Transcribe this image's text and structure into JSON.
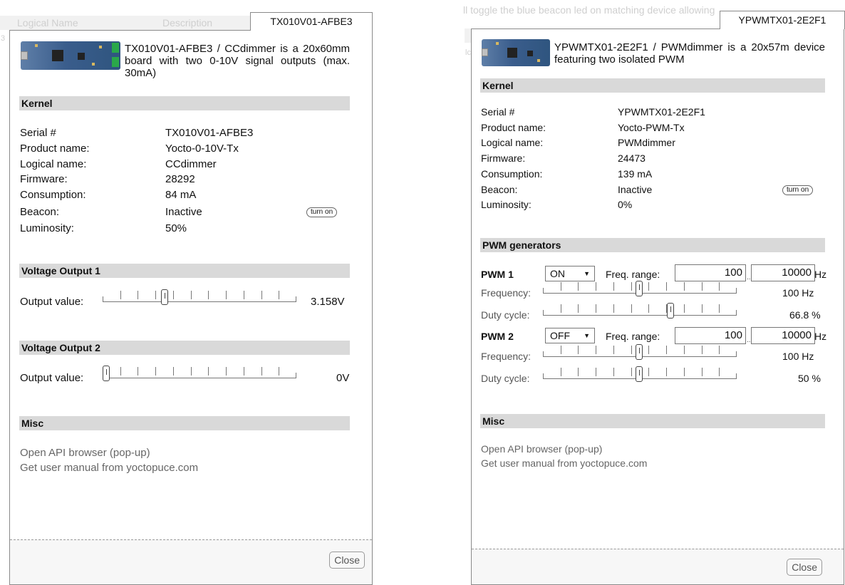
{
  "background": {
    "left_col_logical_name": "Logical Name",
    "left_col_description": "Description",
    "left_fragment": "3",
    "right_hint": "ll toggle the blue beacon led on matching device allowing you to locate it",
    "right_fragment": "lc"
  },
  "left_window": {
    "tab_title": "TX010V01-AFBE3",
    "description": "TX010V01-AFBE3 / CCdimmer is a 20x60mm board with two 0-10V signal outputs (max. 30mA)",
    "kernel": {
      "heading": "Kernel",
      "rows": [
        {
          "label": "Serial #",
          "value": "TX010V01-AFBE3"
        },
        {
          "label": "Product name:",
          "value": "Yocto-0-10V-Tx"
        },
        {
          "label": "Logical name:",
          "value": "CCdimmer"
        },
        {
          "label": "Firmware:",
          "value": "28292"
        },
        {
          "label": "Consumption:",
          "value": "84 mA"
        },
        {
          "label": "Beacon:",
          "value": "Inactive"
        },
        {
          "label": "Luminosity:",
          "value": "50%"
        }
      ],
      "beacon_button": "turn on"
    },
    "voltage1": {
      "heading": "Voltage Output 1",
      "label": "Output value:",
      "value": "3.158V",
      "level": 0.316
    },
    "voltage2": {
      "heading": "Voltage Output 2",
      "label": "Output value:",
      "value": "0V",
      "level": 0.0
    },
    "misc": {
      "heading": "Misc",
      "links": [
        "Open API browser (pop-up)",
        "Get user manual from yoctopuce.com"
      ]
    },
    "close": "Close"
  },
  "right_window": {
    "tab_title": "YPWMTX01-2E2F1",
    "description": "YPWMTX01-2E2F1 / PWMdimmer is a 20x57m device featuring two isolated PWM",
    "kernel": {
      "heading": "Kernel",
      "rows": [
        {
          "label": "Serial #",
          "value": "YPWMTX01-2E2F1"
        },
        {
          "label": "Product name:",
          "value": "Yocto-PWM-Tx"
        },
        {
          "label": "Logical name:",
          "value": "PWMdimmer"
        },
        {
          "label": "Firmware:",
          "value": "24473"
        },
        {
          "label": "Consumption:",
          "value": "139 mA"
        },
        {
          "label": "Beacon:",
          "value": "Inactive"
        },
        {
          "label": "Luminosity:",
          "value": "0%"
        }
      ],
      "beacon_button": "turn on"
    },
    "pwm": {
      "heading": "PWM generators",
      "freq_range_label": "Freq. range:",
      "dots": "...",
      "hz": "Hz",
      "frequency_label": "Frequency:",
      "duty_label": "Duty cycle:",
      "gen1": {
        "name": "PWM 1",
        "state": "ON",
        "range_min": "100",
        "range_max": "10000",
        "frequency": "100 Hz",
        "frequency_level": 0.5,
        "duty": "66.8 %",
        "duty_level": 0.668
      },
      "gen2": {
        "name": "PWM 2",
        "state": "OFF",
        "range_min": "100",
        "range_max": "10000",
        "frequency": "100 Hz",
        "frequency_level": 0.5,
        "duty": "50 %",
        "duty_level": 0.5
      }
    },
    "misc": {
      "heading": "Misc",
      "links": [
        "Open API browser (pop-up)",
        "Get user manual from yoctopuce.com"
      ]
    },
    "close": "Close"
  },
  "icons": {
    "select_arrow": "▼"
  }
}
